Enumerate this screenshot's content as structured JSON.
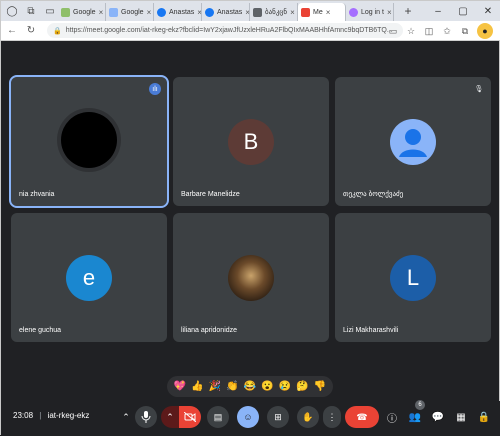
{
  "browser": {
    "tabs": [
      {
        "label": "Google",
        "fav_color": "#8fbf6a"
      },
      {
        "label": "Google",
        "fav_color": "#8ab4f8"
      },
      {
        "label": "Anastas",
        "fav_color": "#1877f2"
      },
      {
        "label": "Anastas",
        "fav_color": "#1877f2"
      },
      {
        "label": "ბანკცნ",
        "fav_color": "#5f6368"
      },
      {
        "label": "Me",
        "fav_color": "#ea4335"
      },
      {
        "label": "Log in t",
        "fav_color": "#a56eff"
      }
    ],
    "url": "https://meet.google.com/iat-rkeg-ekz?fbclid=IwY2xjawJfUzxleHRuA2FlbQIxMAABHhfAmnc9bqDTB6TQ..."
  },
  "participants": [
    {
      "name": "nia zhvania",
      "initial": "",
      "avatar_color": "#000000",
      "speaking": true
    },
    {
      "name": "Barbare Manelidze",
      "initial": "B",
      "avatar_color": "#5d3b36"
    },
    {
      "name": "თეკლა ბოლქვაძე",
      "initial": "",
      "avatar_color": "#8ab4f8",
      "muted": true
    },
    {
      "name": "elene guchua",
      "initial": "e",
      "avatar_color": "#1a87d0"
    },
    {
      "name": "liliana apridonidze",
      "initial": "",
      "avatar_color": "#6b4a2a"
    },
    {
      "name": "Lizi Makharashvili",
      "initial": "L",
      "avatar_color": "#1c5ea8"
    }
  ],
  "reactions": [
    "💖",
    "👍",
    "🎉",
    "👏",
    "😂",
    "😮",
    "😢",
    "🤔",
    "👎"
  ],
  "meeting": {
    "time": "23:08",
    "code": "iat-rkeg-ekz",
    "people_count": "6"
  }
}
